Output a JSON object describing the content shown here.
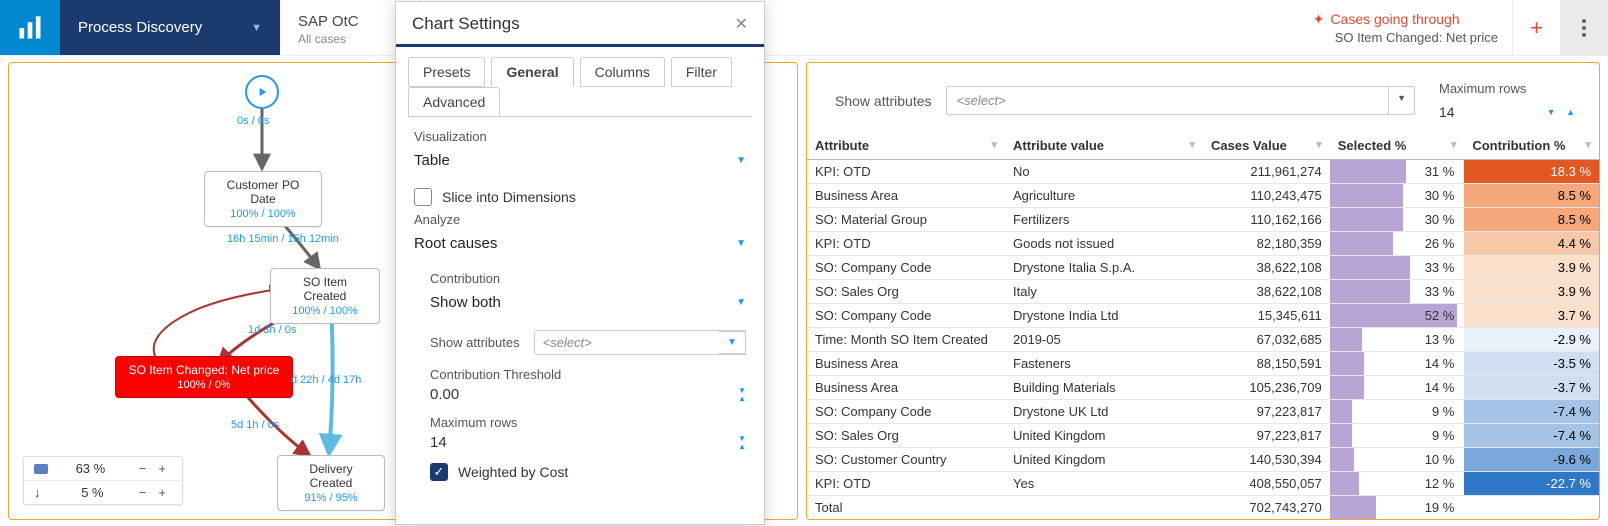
{
  "nav": {
    "title": "Process Discovery"
  },
  "context": {
    "title": "SAP OtC",
    "sub": "All cases"
  },
  "alert": {
    "line1": "Cases going through",
    "line2": "SO Item Changed: Net price"
  },
  "graph": {
    "start_label": "0s / 0s",
    "nodes": {
      "po": {
        "title": "Customer PO Date",
        "sub": "100% / 100%"
      },
      "so": {
        "title": "SO Item Created",
        "sub": "100% / 100%"
      },
      "chg": {
        "title": "SO Item Changed: Net price",
        "sub": "100% / 0%"
      },
      "del": {
        "title": "Delivery Created",
        "sub": "91% / 95%"
      }
    },
    "edges": {
      "po_so": "16h 15min / 15h 12min",
      "so_chg": "1d 3h / 0s",
      "so_del": "d 22h / 4d 17h",
      "chg_del": "5d 1h / 0s"
    }
  },
  "sliders": {
    "bar_pct": "63 %",
    "arrow_pct": "5 %"
  },
  "settings": {
    "title": "Chart Settings",
    "tabs": {
      "presets": "Presets",
      "general": "General",
      "columns": "Columns",
      "filter": "Filter",
      "advanced": "Advanced"
    },
    "labels": {
      "visualization": "Visualization",
      "slice": "Slice into Dimensions",
      "analyze": "Analyze",
      "contribution": "Contribution",
      "show_attributes": "Show attributes",
      "contribution_threshold": "Contribution Threshold",
      "maximum_rows": "Maximum rows",
      "weighted": "Weighted by Cost",
      "select_placeholder": "<select>"
    },
    "values": {
      "visualization": "Table",
      "analyze": "Root causes",
      "contribution": "Show both",
      "contribution_threshold": "0.00",
      "maximum_rows": "14"
    }
  },
  "right_panel": {
    "show_attributes_label": "Show attributes",
    "select_placeholder": "<select>",
    "max_rows_label": "Maximum rows",
    "max_rows_value": "14",
    "headers": {
      "attribute": "Attribute",
      "attribute_value": "Attribute value",
      "cases_value": "Cases Value",
      "selected": "Selected %",
      "contribution": "Contribution %"
    }
  },
  "chart_data": {
    "type": "table",
    "columns": [
      "Attribute",
      "Attribute value",
      "Cases Value",
      "Selected %",
      "Contribution %"
    ],
    "rows": [
      {
        "attribute": "KPI: OTD",
        "value": "No",
        "cases": "211,961,274",
        "selected": 31,
        "contribution": 18.3
      },
      {
        "attribute": "Business Area",
        "value": "Agriculture",
        "cases": "110,243,475",
        "selected": 30,
        "contribution": 8.5
      },
      {
        "attribute": "SO: Material Group",
        "value": "Fertilizers",
        "cases": "110,162,166",
        "selected": 30,
        "contribution": 8.5
      },
      {
        "attribute": "KPI: OTD",
        "value": "Goods not issued",
        "cases": "82,180,359",
        "selected": 26,
        "contribution": 4.4
      },
      {
        "attribute": "SO: Company Code",
        "value": "Drystone Italia S.p.A.",
        "cases": "38,622,108",
        "selected": 33,
        "contribution": 3.9
      },
      {
        "attribute": "SO: Sales Org",
        "value": "Italy",
        "cases": "38,622,108",
        "selected": 33,
        "contribution": 3.9
      },
      {
        "attribute": "SO: Company Code",
        "value": "Drystone India Ltd",
        "cases": "15,345,611",
        "selected": 52,
        "contribution": 3.7
      },
      {
        "attribute": "Time: Month SO Item Created",
        "value": "2019-05",
        "cases": "67,032,685",
        "selected": 13,
        "contribution": -2.9
      },
      {
        "attribute": "Business Area",
        "value": "Fasteners",
        "cases": "88,150,591",
        "selected": 14,
        "contribution": -3.5
      },
      {
        "attribute": "Business Area",
        "value": "Building Materials",
        "cases": "105,236,709",
        "selected": 14,
        "contribution": -3.7
      },
      {
        "attribute": "SO: Company Code",
        "value": "Drystone UK Ltd",
        "cases": "97,223,817",
        "selected": 9,
        "contribution": -7.4
      },
      {
        "attribute": "SO: Sales Org",
        "value": "United Kingdom",
        "cases": "97,223,817",
        "selected": 9,
        "contribution": -7.4
      },
      {
        "attribute": "SO: Customer Country",
        "value": "United Kingdom",
        "cases": "140,530,394",
        "selected": 10,
        "contribution": -9.6
      },
      {
        "attribute": "KPI: OTD",
        "value": "Yes",
        "cases": "408,550,057",
        "selected": 12,
        "contribution": -22.7
      }
    ],
    "total": {
      "attribute": "Total",
      "value": "",
      "cases": "702,743,270",
      "selected": 19,
      "contribution": null
    }
  }
}
